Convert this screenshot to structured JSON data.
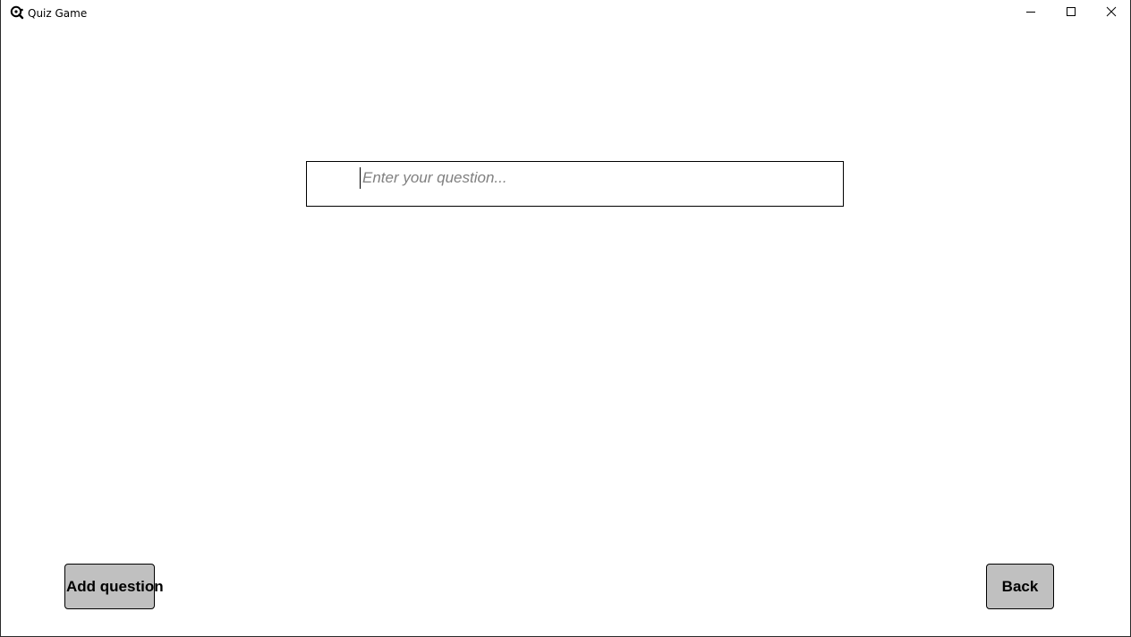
{
  "window": {
    "title": "Quiz Game",
    "icon": "quiz-app-icon",
    "controls": {
      "minimize": "minimize-icon",
      "maximize": "maximize-icon",
      "close": "close-icon"
    }
  },
  "form": {
    "question_placeholder": "Enter your question...",
    "question_value": ""
  },
  "actions": {
    "add_label": "Add question",
    "back_label": "Back"
  },
  "colors": {
    "button_bg": "#c0c0c0",
    "border": "#000000",
    "placeholder": "#808080"
  }
}
